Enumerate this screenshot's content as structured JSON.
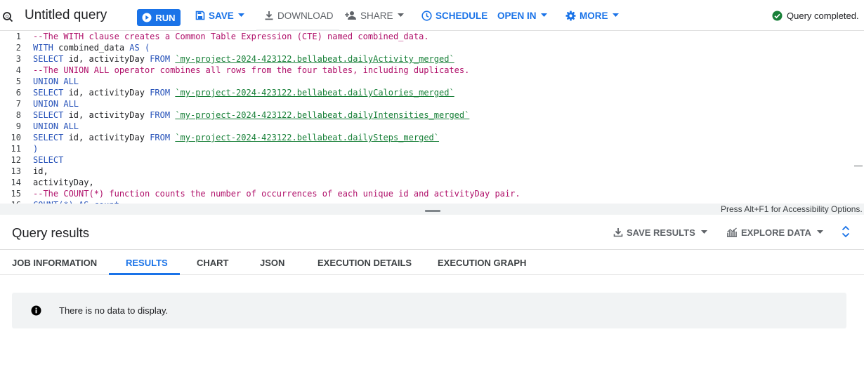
{
  "toolbar": {
    "title": "Untitled query",
    "run_label": "RUN",
    "save_label": "SAVE",
    "download_label": "DOWNLOAD",
    "share_label": "SHARE",
    "schedule_label": "SCHEDULE",
    "open_in_label": "OPEN IN",
    "more_label": "MORE",
    "status": "Query completed."
  },
  "editor": {
    "lines": [
      [
        {
          "t": "--The WITH clause creates a Common Table Expression (CTE) named combined_data.",
          "c": "cm"
        }
      ],
      [
        {
          "t": "WITH",
          "c": "kw"
        },
        {
          "t": " combined_data ",
          "c": "id"
        },
        {
          "t": "AS (",
          "c": "kw"
        }
      ],
      [
        {
          "t": "SELECT",
          "c": "kw"
        },
        {
          "t": " id, activityDay ",
          "c": "id"
        },
        {
          "t": "FROM",
          "c": "kw"
        },
        {
          "t": " ",
          "c": "id"
        },
        {
          "t": "`my-project-2024-423122.bellabeat.dailyActivity_merged`",
          "c": "tbl"
        }
      ],
      [
        {
          "t": "--The UNION ALL operator combines all rows from the four tables, including duplicates.",
          "c": "cm"
        }
      ],
      [
        {
          "t": "UNION ALL",
          "c": "kw"
        }
      ],
      [
        {
          "t": "SELECT",
          "c": "kw"
        },
        {
          "t": " id, activityDay ",
          "c": "id"
        },
        {
          "t": "FROM",
          "c": "kw"
        },
        {
          "t": " ",
          "c": "id"
        },
        {
          "t": "`my-project-2024-423122.bellabeat.dailyCalories_merged`",
          "c": "tbl"
        }
      ],
      [
        {
          "t": "UNION ALL",
          "c": "kw"
        }
      ],
      [
        {
          "t": "SELECT",
          "c": "kw"
        },
        {
          "t": " id, activityDay ",
          "c": "id"
        },
        {
          "t": "FROM",
          "c": "kw"
        },
        {
          "t": " ",
          "c": "id"
        },
        {
          "t": "`my-project-2024-423122.bellabeat.dailyIntensities_merged`",
          "c": "tbl"
        }
      ],
      [
        {
          "t": "UNION ALL",
          "c": "kw"
        }
      ],
      [
        {
          "t": "SELECT",
          "c": "kw"
        },
        {
          "t": " id, activityDay ",
          "c": "id"
        },
        {
          "t": "FROM",
          "c": "kw"
        },
        {
          "t": " ",
          "c": "id"
        },
        {
          "t": "`my-project-2024-423122.bellabeat.dailySteps_merged`",
          "c": "tbl"
        }
      ],
      [
        {
          "t": ")",
          "c": "kw"
        }
      ],
      [
        {
          "t": "SELECT",
          "c": "kw"
        }
      ],
      [
        {
          "t": "id,",
          "c": "id"
        }
      ],
      [
        {
          "t": "activityDay,",
          "c": "id"
        }
      ],
      [
        {
          "t": "--The COUNT(*) function counts the number of occurrences of each unique id and activityDay pair.",
          "c": "cm"
        }
      ],
      [
        {
          "t": "COUNT(*) AS count",
          "c": "kw"
        }
      ]
    ]
  },
  "accessibility_hint": "Press Alt+F1 for Accessibility Options.",
  "results": {
    "title": "Query results",
    "save_results_label": "SAVE RESULTS",
    "explore_data_label": "EXPLORE DATA",
    "tabs": [
      {
        "label": "JOB INFORMATION",
        "name": "tab-job-information"
      },
      {
        "label": "RESULTS",
        "name": "tab-results",
        "active": true
      },
      {
        "label": "CHART",
        "name": "tab-chart"
      },
      {
        "label": "JSON",
        "name": "tab-json"
      },
      {
        "label": "EXECUTION DETAILS",
        "name": "tab-execution-details"
      },
      {
        "label": "EXECUTION GRAPH",
        "name": "tab-execution-graph"
      }
    ],
    "empty_message": "There is no data to display."
  },
  "colors": {
    "accent": "#1a73e8",
    "success": "#188038",
    "comment": "#b0106a",
    "keyword": "#2450b8"
  },
  "icons": {
    "query": "query-icon",
    "run": "play-circle-icon",
    "save": "save-icon",
    "download": "download-icon",
    "share": "person-add-icon",
    "schedule": "clock-icon",
    "more": "gear-icon",
    "status": "check-circle-icon",
    "save_results": "download-icon",
    "explore_data": "chart-icon",
    "expand": "unfold-icon",
    "info": "info-icon"
  }
}
